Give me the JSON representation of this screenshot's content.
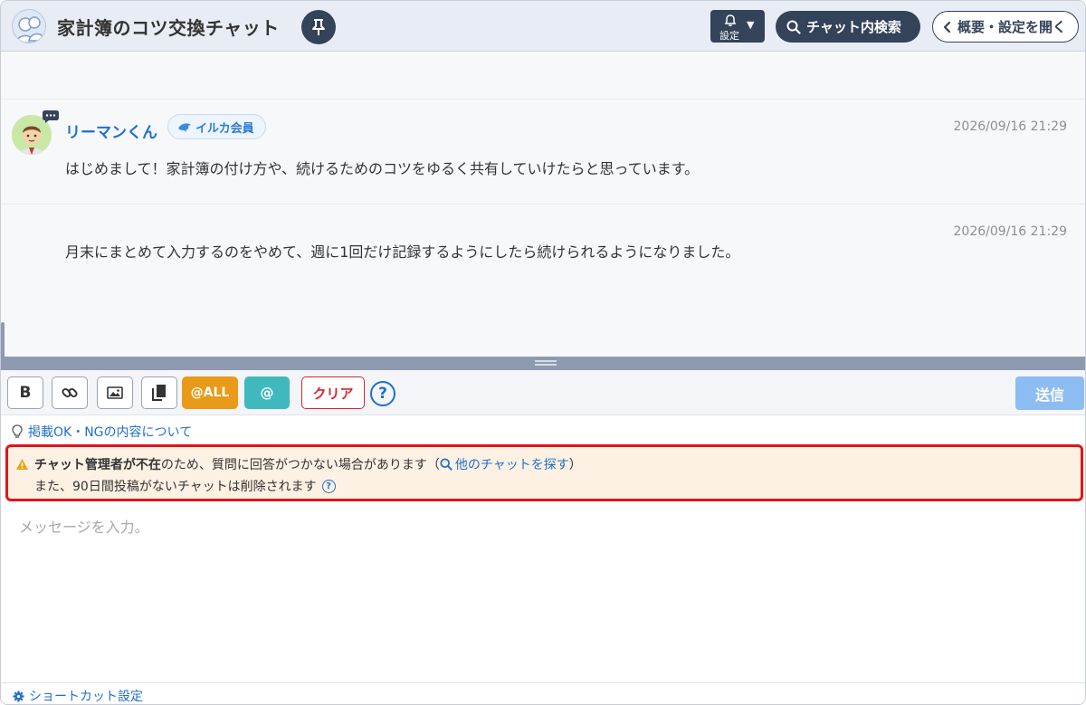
{
  "header": {
    "title": "家計簿のコツ交換チャット",
    "notify_label": "設定",
    "search_label": "チャット内検索",
    "overview_label": "概要・設定を開く"
  },
  "messages": [
    {
      "user": "リーマンくん",
      "badge": "イルカ会員",
      "timestamp": "2026/09/16 21:29",
      "text": "はじめまして！家計簿の付け方や、続けるためのコツをゆるく共有していけたらと思っています。"
    },
    {
      "timestamp": "2026/09/16 21:29",
      "text": "月末にまとめて入力するのをやめて、週に1回だけ記録するようにしたら続けられるようになりました。"
    }
  ],
  "toolbar": {
    "bold_label": "B",
    "at_all_label": "@ALL",
    "at_label": "@",
    "clear_label": "クリア",
    "help_label": "?",
    "send_label": "送信"
  },
  "guideline_link": "掲載OK・NGの内容について",
  "warning": {
    "bold_text": "チャット管理者が不在",
    "text1": "のため、質問に回答がつかない場合があります（",
    "link_text": "他のチャットを探す",
    "text1_end": "）",
    "text2": "また、90日間投稿がないチャットは削除されます"
  },
  "composer": {
    "placeholder": "メッセージを入力。"
  },
  "footer": {
    "shortcut_label": "ショートカット設定"
  },
  "colors": {
    "primary_dark": "#34435a",
    "link_blue": "#1f6fce",
    "at_all": "#e89a18",
    "at": "#3fb9bd",
    "clear": "#d8242c",
    "send_disabled": "#8dbcf3",
    "warning_bg": "#fdf1e3",
    "warning_border": "#e0141e"
  }
}
